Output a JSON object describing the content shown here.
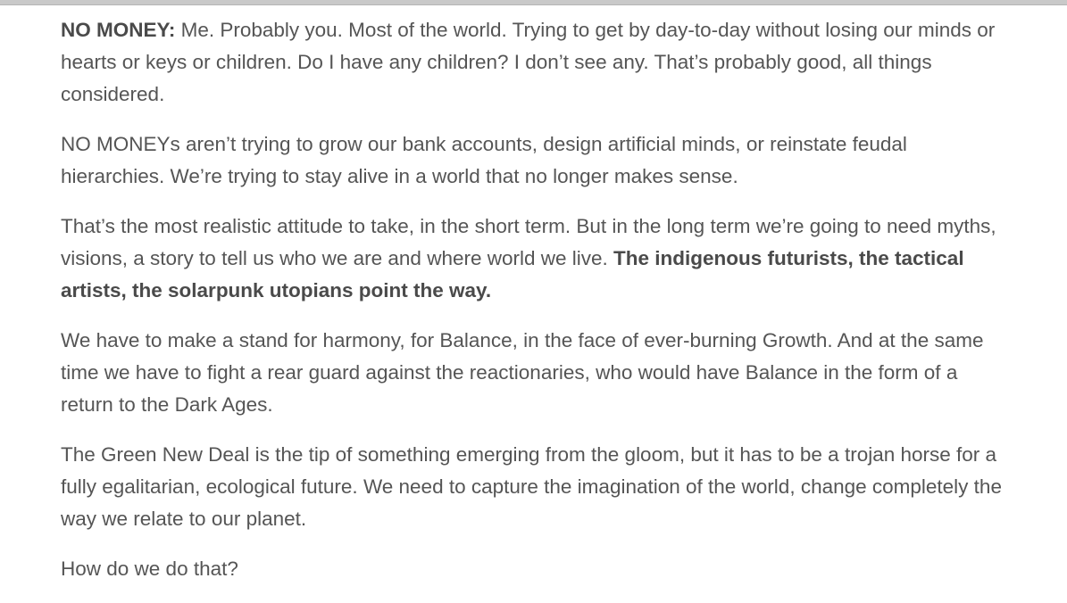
{
  "article": {
    "p1": {
      "lead": "NO MONEY:",
      "text": " Me. Probably you. Most of the world. Trying to get by day-to-day without losing our minds or hearts or keys or children. Do I have any children? I don’t see any. That’s probably good, all things considered."
    },
    "p2": {
      "text": "NO MONEYs aren’t trying to grow our bank accounts, design artificial minds, or reinstate feudal hierarchies. We’re trying to stay alive in a world that no longer makes sense."
    },
    "p3": {
      "text": "That’s the most realistic attitude to take, in the short term. But in the long term we’re going to need myths, visions, a story to tell us who we are and where world we live. ",
      "bold": "The indigenous futurists, the tactical artists, the solarpunk utopians point the way."
    },
    "p4": {
      "text": "We have to make a stand for harmony, for Balance, in the face of ever-burning Growth. And at the same time we have to fight a rear guard against the reactionaries, who would have Balance in the form of a return to the Dark Ages."
    },
    "p5": {
      "text": "The Green New Deal is the tip of something emerging from the gloom, but it has to be a trojan horse for a fully egalitarian, ecological future. We need to capture the imagination of the world, change completely the way we relate to our planet."
    },
    "p6": {
      "text": "How do we do that?"
    }
  }
}
